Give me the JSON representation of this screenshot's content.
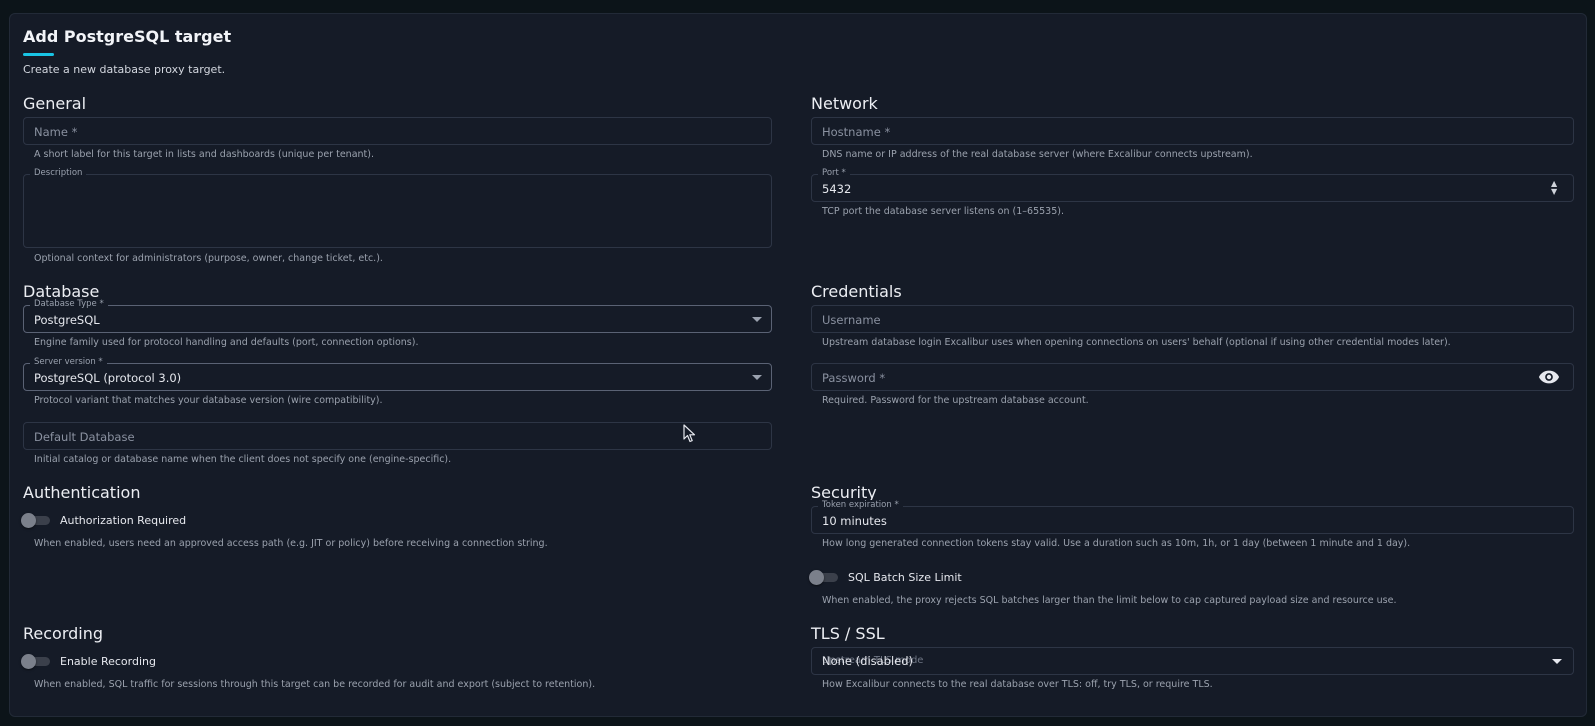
{
  "header": {
    "title": "Add PostgreSQL target",
    "subtitle": "Create a new database proxy target."
  },
  "general": {
    "heading": "General",
    "name": {
      "placeholder": "Name *",
      "help": "A short label for this target in lists and dashboards (unique per tenant)."
    },
    "description": {
      "label": "Description",
      "value": "",
      "help": "Optional context for administrators (purpose, owner, change ticket, etc.)."
    }
  },
  "network": {
    "heading": "Network",
    "hostname": {
      "placeholder": "Hostname *",
      "help": "DNS name or IP address of the real database server (where Excalibur connects upstream)."
    },
    "port": {
      "label": "Port *",
      "value": "5432",
      "help": "TCP port the database server listens on (1–65535)."
    }
  },
  "database": {
    "heading": "Database",
    "type": {
      "label": "Database Type *",
      "value": "PostgreSQL",
      "help": "Engine family used for protocol handling and defaults (port, connection options)."
    },
    "server_version": {
      "label": "Server version *",
      "value": "PostgreSQL (protocol 3.0)",
      "help": "Protocol variant that matches your database version (wire compatibility)."
    },
    "default_db": {
      "placeholder": "Default Database",
      "help": "Initial catalog or database name when the client does not specify one (engine-specific)."
    }
  },
  "credentials": {
    "heading": "Credentials",
    "username": {
      "placeholder": "Username",
      "help": "Upstream database login Excalibur uses when opening connections on users' behalf (optional if using other credential modes later)."
    },
    "password": {
      "placeholder": "Password *",
      "help": "Required. Password for the upstream database account.",
      "icon": "eye-icon"
    }
  },
  "authentication": {
    "heading": "Authentication",
    "authorization": {
      "label": "Authorization Required",
      "enabled": false,
      "help": "When enabled, users need an approved access path (e.g. JIT or policy) before receiving a connection string."
    }
  },
  "security": {
    "heading": "Security",
    "token": {
      "label": "Token expiration *",
      "value": "10 minutes",
      "help": "How long generated connection tokens stay valid. Use a duration such as 10m, 1h, or 1 day (between 1 minute and 1 day)."
    },
    "batch": {
      "label": "SQL Batch Size Limit",
      "enabled": false,
      "help": "When enabled, the proxy rejects SQL batches larger than the limit below to cap captured payload size and resource use."
    }
  },
  "recording": {
    "heading": "Recording",
    "enable": {
      "label": "Enable Recording",
      "enabled": false,
      "help": "When enabled, SQL traffic for sessions through this target can be recorded for audit and export (subject to retention)."
    }
  },
  "tls": {
    "heading": "TLS / SSL",
    "mode": {
      "label": "Upstream TLS mode",
      "value": "None (disabled)",
      "help": "How Excalibur connects to the real database over TLS: off, try TLS, or require TLS."
    }
  },
  "colors": {
    "accent": "#19c4e4",
    "background": "#151b27",
    "page": "#0c1419"
  }
}
